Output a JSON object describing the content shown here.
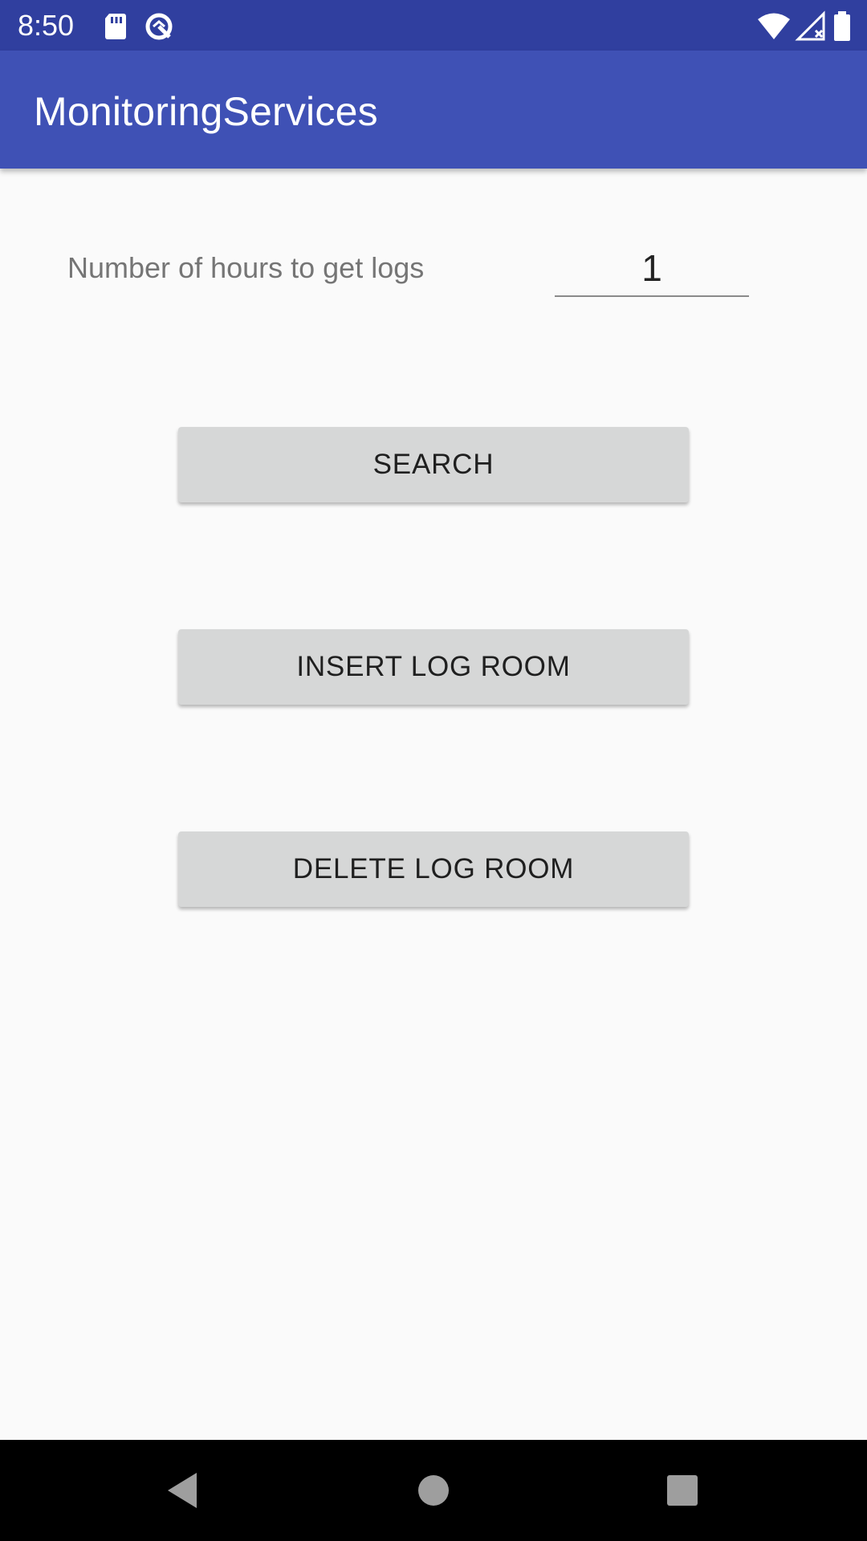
{
  "status_bar": {
    "time": "8:50",
    "left_icons": [
      "sd-card-icon",
      "data-saver-icon"
    ],
    "right_icons": [
      "wifi-icon",
      "cellular-no-service-icon",
      "battery-icon"
    ]
  },
  "app_bar": {
    "title": "MonitoringServices"
  },
  "form": {
    "hours_label": "Number of hours to get logs",
    "hours_value": "1"
  },
  "buttons": {
    "search": "SEARCH",
    "insert_log_room": "INSERT LOG ROOM",
    "delete_log_room": "DELETE LOG ROOM"
  },
  "nav_bar": {
    "icons": [
      "back-icon",
      "home-icon",
      "recents-icon"
    ]
  },
  "colors": {
    "status_bar": "#303f9f",
    "app_bar": "#3f51b5",
    "background": "#fafafa",
    "button": "#d6d7d7"
  }
}
